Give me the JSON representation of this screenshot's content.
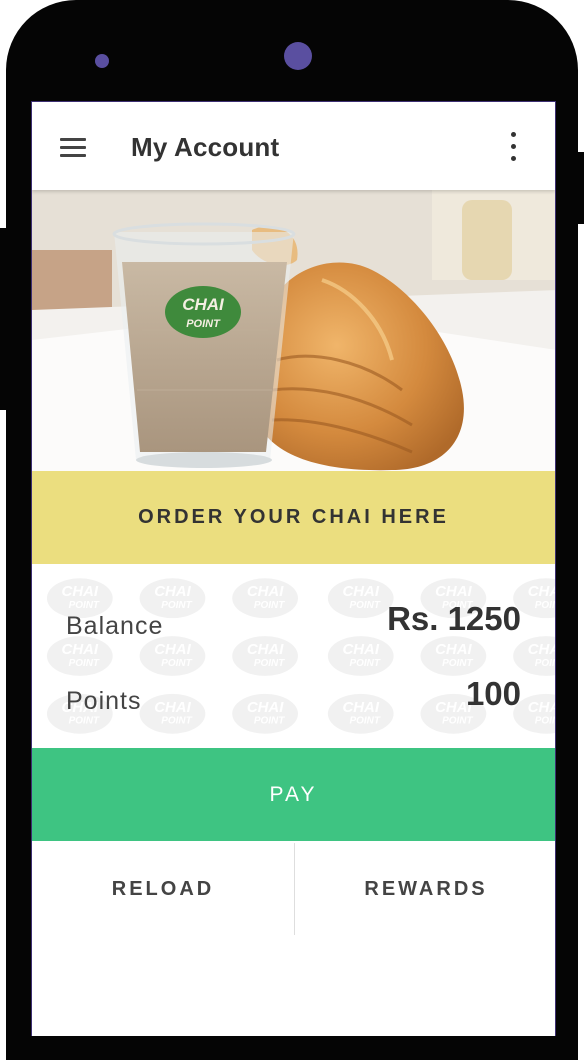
{
  "appbar": {
    "title": "My Account",
    "menu_icon": "hamburger-menu-icon",
    "more_icon": "more-vertical-icon"
  },
  "hero": {
    "logo_line1": "CHAI",
    "logo_line2": "POINT"
  },
  "order_button": {
    "label": "ORDER YOUR CHAI HERE"
  },
  "account": {
    "balance_label": "Balance",
    "balance_value": "Rs. 1250",
    "points_label": "Points",
    "points_value": "100"
  },
  "pattern_logo": {
    "line1": "CHAI",
    "line2": "POINT"
  },
  "pay_button": {
    "label": "PAY"
  },
  "bottom": {
    "reload_label": "RELOAD",
    "rewards_label": "REWARDS"
  },
  "colors": {
    "order_bg": "#ebde7f",
    "pay_bg": "#3ec482",
    "phone_frame": "#050505",
    "camera": "#5a4fa0"
  }
}
